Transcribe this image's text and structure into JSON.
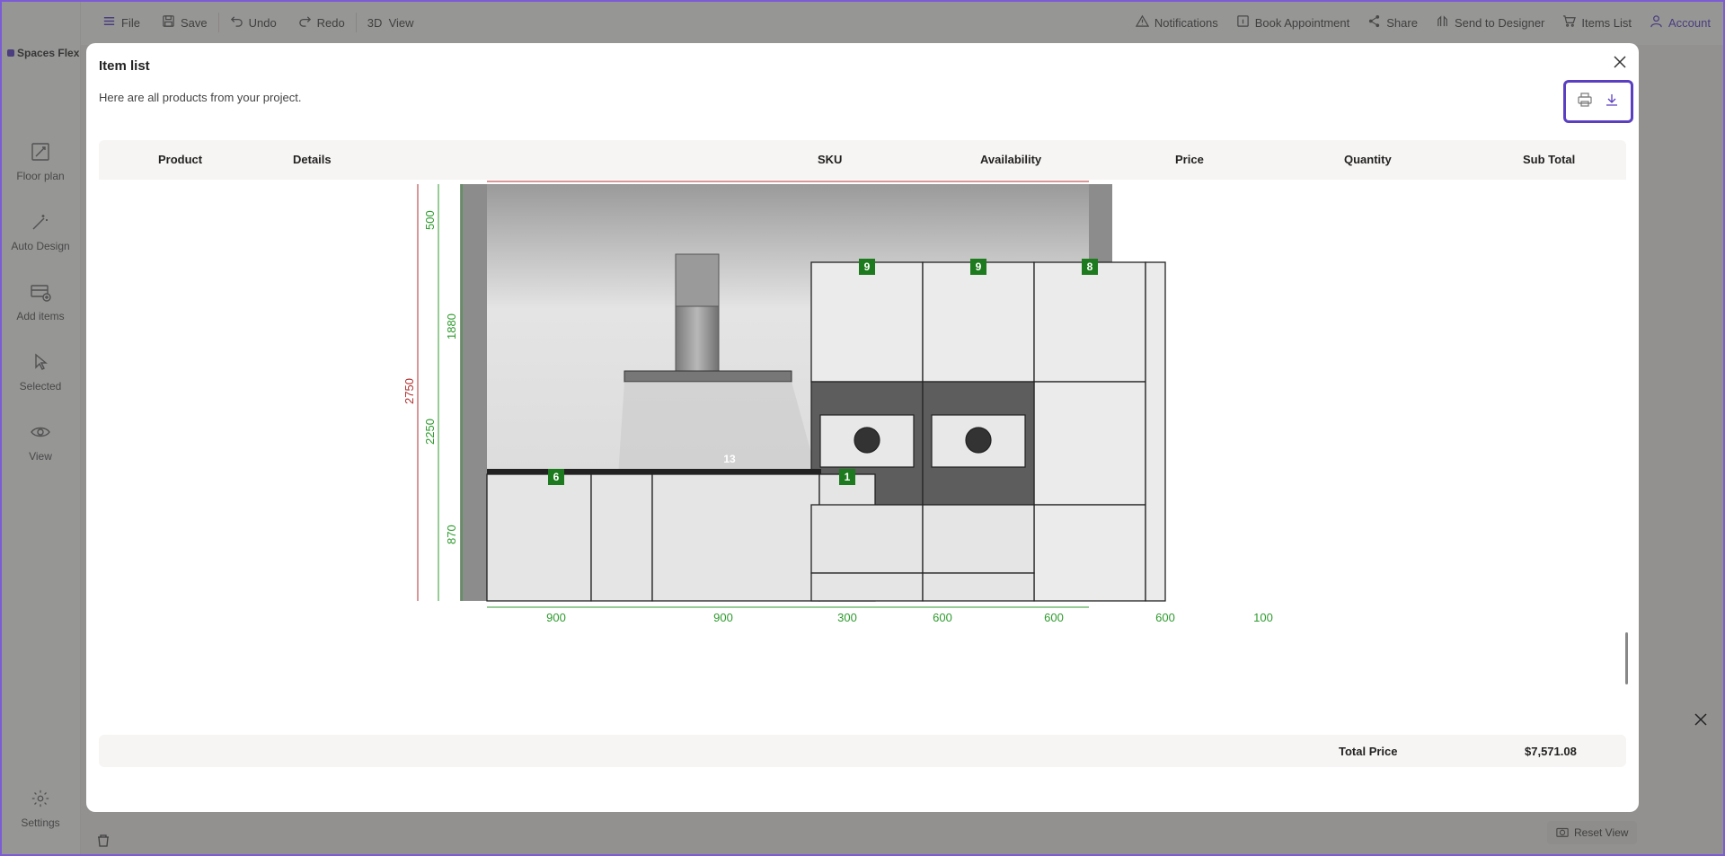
{
  "app": {
    "logo": "Spaces Flex"
  },
  "toolbar": {
    "file": "File",
    "save": "Save",
    "undo": "Undo",
    "redo": "Redo",
    "view3d": "3D  View",
    "notifications": "Notifications",
    "book": "Book Appointment",
    "share": "Share",
    "send": "Send to Designer",
    "items": "Items List",
    "account": "Account"
  },
  "sidebar": {
    "items": [
      {
        "label": "Floor plan",
        "icon": "floor-plan-icon"
      },
      {
        "label": "Auto Design",
        "icon": "magic-wand-icon"
      },
      {
        "label": "Add items",
        "icon": "add-items-icon"
      },
      {
        "label": "Selected",
        "icon": "cursor-icon"
      },
      {
        "label": "View",
        "icon": "eye-icon"
      }
    ],
    "settings": "Settings"
  },
  "modal": {
    "title": "Item list",
    "subtitle": "Here are all products from your project.",
    "columns": [
      "Product",
      "Details",
      "SKU",
      "Availability",
      "Price",
      "Quantity",
      "Sub Total"
    ],
    "total_label": "Total Price",
    "total_value": "$7,571.08"
  },
  "drawing": {
    "heights": [
      "500",
      "1880",
      "2750",
      "2250",
      "870"
    ],
    "widths": [
      "900",
      "900",
      "300",
      "600",
      "600",
      "600",
      "100"
    ],
    "markers": [
      "9",
      "9",
      "8",
      "6",
      "1",
      "13"
    ]
  },
  "reset_view": "Reset View",
  "colors": {
    "accent": "#5a3fc0",
    "dim_green": "#2e9a2e",
    "dim_red": "#b03030",
    "marker": "#1e7a1e"
  }
}
